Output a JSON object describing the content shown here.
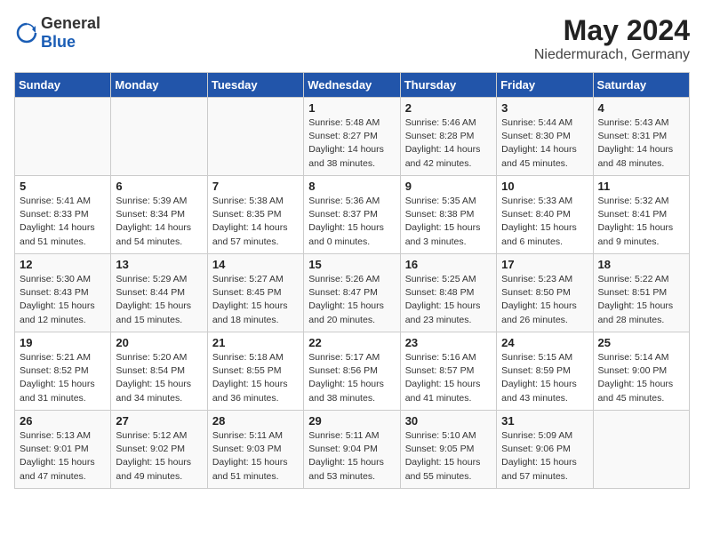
{
  "header": {
    "logo": {
      "general": "General",
      "blue": "Blue"
    },
    "title": "May 2024",
    "location": "Niedermurach, Germany"
  },
  "weekdays": [
    "Sunday",
    "Monday",
    "Tuesday",
    "Wednesday",
    "Thursday",
    "Friday",
    "Saturday"
  ],
  "weeks": [
    [
      {
        "day": "",
        "info": ""
      },
      {
        "day": "",
        "info": ""
      },
      {
        "day": "",
        "info": ""
      },
      {
        "day": "1",
        "info": "Sunrise: 5:48 AM\nSunset: 8:27 PM\nDaylight: 14 hours\nand 38 minutes."
      },
      {
        "day": "2",
        "info": "Sunrise: 5:46 AM\nSunset: 8:28 PM\nDaylight: 14 hours\nand 42 minutes."
      },
      {
        "day": "3",
        "info": "Sunrise: 5:44 AM\nSunset: 8:30 PM\nDaylight: 14 hours\nand 45 minutes."
      },
      {
        "day": "4",
        "info": "Sunrise: 5:43 AM\nSunset: 8:31 PM\nDaylight: 14 hours\nand 48 minutes."
      }
    ],
    [
      {
        "day": "5",
        "info": "Sunrise: 5:41 AM\nSunset: 8:33 PM\nDaylight: 14 hours\nand 51 minutes."
      },
      {
        "day": "6",
        "info": "Sunrise: 5:39 AM\nSunset: 8:34 PM\nDaylight: 14 hours\nand 54 minutes."
      },
      {
        "day": "7",
        "info": "Sunrise: 5:38 AM\nSunset: 8:35 PM\nDaylight: 14 hours\nand 57 minutes."
      },
      {
        "day": "8",
        "info": "Sunrise: 5:36 AM\nSunset: 8:37 PM\nDaylight: 15 hours\nand 0 minutes."
      },
      {
        "day": "9",
        "info": "Sunrise: 5:35 AM\nSunset: 8:38 PM\nDaylight: 15 hours\nand 3 minutes."
      },
      {
        "day": "10",
        "info": "Sunrise: 5:33 AM\nSunset: 8:40 PM\nDaylight: 15 hours\nand 6 minutes."
      },
      {
        "day": "11",
        "info": "Sunrise: 5:32 AM\nSunset: 8:41 PM\nDaylight: 15 hours\nand 9 minutes."
      }
    ],
    [
      {
        "day": "12",
        "info": "Sunrise: 5:30 AM\nSunset: 8:43 PM\nDaylight: 15 hours\nand 12 minutes."
      },
      {
        "day": "13",
        "info": "Sunrise: 5:29 AM\nSunset: 8:44 PM\nDaylight: 15 hours\nand 15 minutes."
      },
      {
        "day": "14",
        "info": "Sunrise: 5:27 AM\nSunset: 8:45 PM\nDaylight: 15 hours\nand 18 minutes."
      },
      {
        "day": "15",
        "info": "Sunrise: 5:26 AM\nSunset: 8:47 PM\nDaylight: 15 hours\nand 20 minutes."
      },
      {
        "day": "16",
        "info": "Sunrise: 5:25 AM\nSunset: 8:48 PM\nDaylight: 15 hours\nand 23 minutes."
      },
      {
        "day": "17",
        "info": "Sunrise: 5:23 AM\nSunset: 8:50 PM\nDaylight: 15 hours\nand 26 minutes."
      },
      {
        "day": "18",
        "info": "Sunrise: 5:22 AM\nSunset: 8:51 PM\nDaylight: 15 hours\nand 28 minutes."
      }
    ],
    [
      {
        "day": "19",
        "info": "Sunrise: 5:21 AM\nSunset: 8:52 PM\nDaylight: 15 hours\nand 31 minutes."
      },
      {
        "day": "20",
        "info": "Sunrise: 5:20 AM\nSunset: 8:54 PM\nDaylight: 15 hours\nand 34 minutes."
      },
      {
        "day": "21",
        "info": "Sunrise: 5:18 AM\nSunset: 8:55 PM\nDaylight: 15 hours\nand 36 minutes."
      },
      {
        "day": "22",
        "info": "Sunrise: 5:17 AM\nSunset: 8:56 PM\nDaylight: 15 hours\nand 38 minutes."
      },
      {
        "day": "23",
        "info": "Sunrise: 5:16 AM\nSunset: 8:57 PM\nDaylight: 15 hours\nand 41 minutes."
      },
      {
        "day": "24",
        "info": "Sunrise: 5:15 AM\nSunset: 8:59 PM\nDaylight: 15 hours\nand 43 minutes."
      },
      {
        "day": "25",
        "info": "Sunrise: 5:14 AM\nSunset: 9:00 PM\nDaylight: 15 hours\nand 45 minutes."
      }
    ],
    [
      {
        "day": "26",
        "info": "Sunrise: 5:13 AM\nSunset: 9:01 PM\nDaylight: 15 hours\nand 47 minutes."
      },
      {
        "day": "27",
        "info": "Sunrise: 5:12 AM\nSunset: 9:02 PM\nDaylight: 15 hours\nand 49 minutes."
      },
      {
        "day": "28",
        "info": "Sunrise: 5:11 AM\nSunset: 9:03 PM\nDaylight: 15 hours\nand 51 minutes."
      },
      {
        "day": "29",
        "info": "Sunrise: 5:11 AM\nSunset: 9:04 PM\nDaylight: 15 hours\nand 53 minutes."
      },
      {
        "day": "30",
        "info": "Sunrise: 5:10 AM\nSunset: 9:05 PM\nDaylight: 15 hours\nand 55 minutes."
      },
      {
        "day": "31",
        "info": "Sunrise: 5:09 AM\nSunset: 9:06 PM\nDaylight: 15 hours\nand 57 minutes."
      },
      {
        "day": "",
        "info": ""
      }
    ]
  ]
}
